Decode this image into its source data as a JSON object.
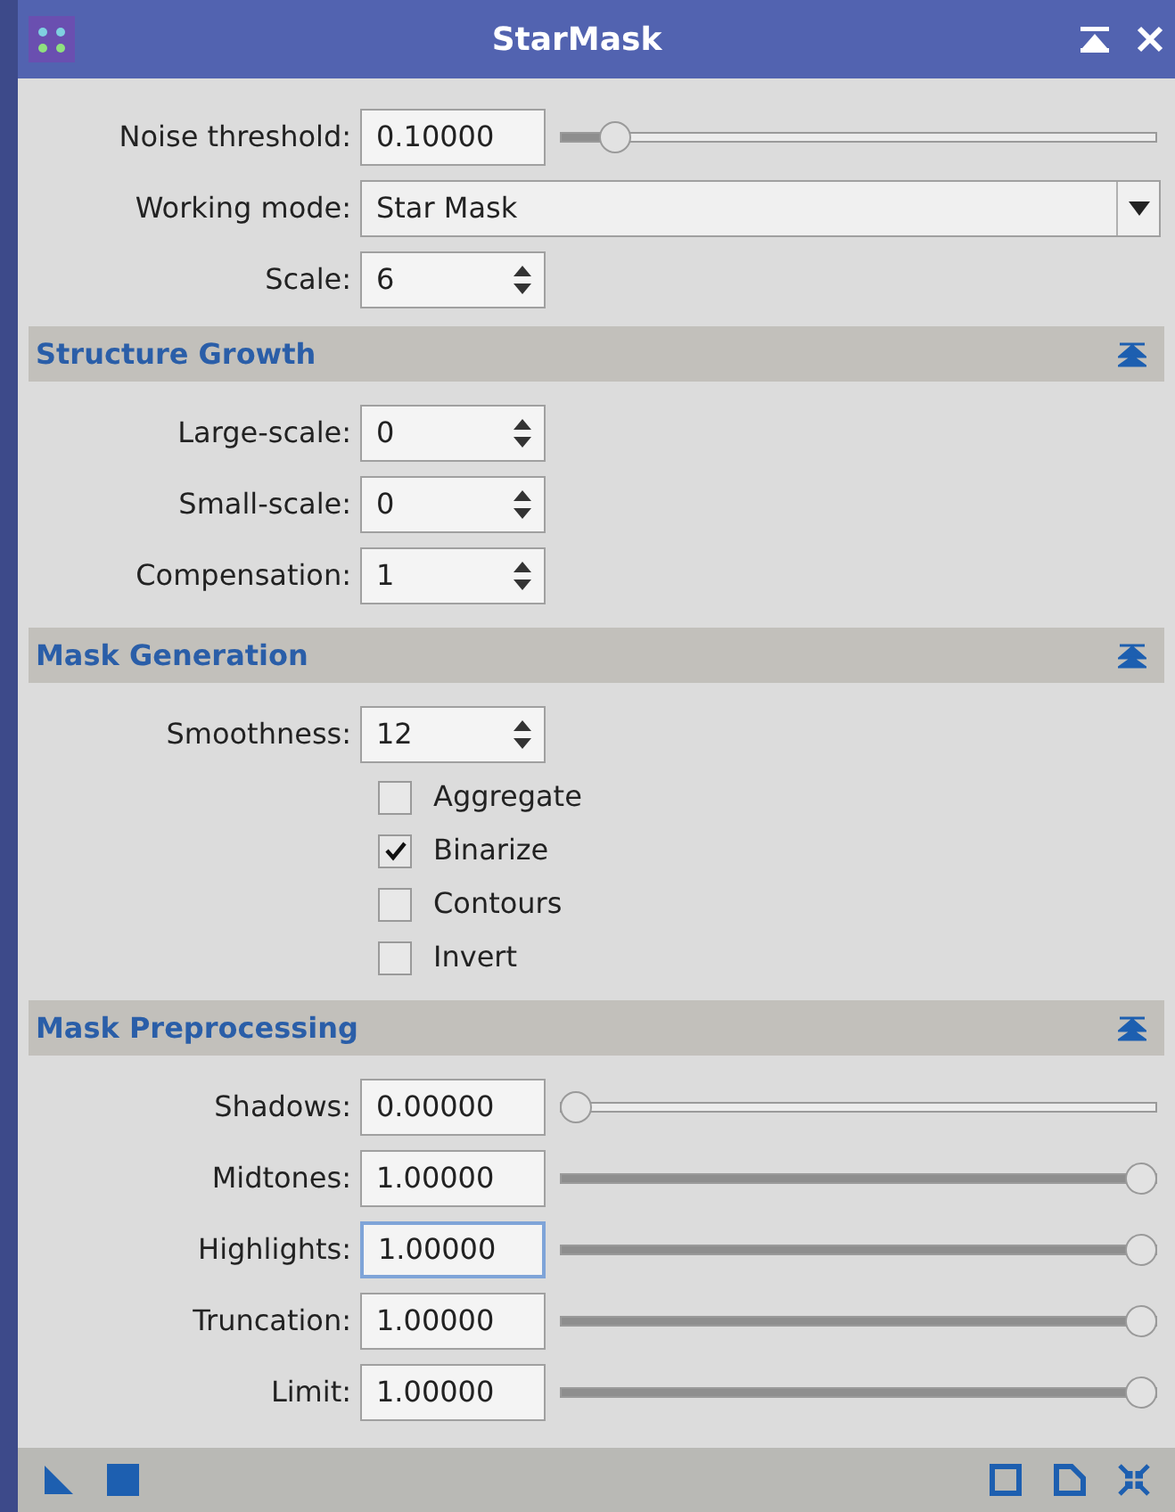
{
  "window": {
    "title": "StarMask"
  },
  "top_rows": [
    {
      "kind": "slider",
      "label": "Noise threshold:",
      "value": "0.10000",
      "level": 0.07
    },
    {
      "kind": "combo",
      "label": "Working mode:",
      "value": "Star Mask"
    },
    {
      "kind": "spin",
      "label": "Scale:",
      "value": "6"
    }
  ],
  "sections": [
    {
      "title": "Structure Growth",
      "expanded": true,
      "rows": [
        {
          "kind": "spin",
          "label": "Large-scale:",
          "value": "0"
        },
        {
          "kind": "spin",
          "label": "Small-scale:",
          "value": "0"
        },
        {
          "kind": "spin",
          "label": "Compensation:",
          "value": "1"
        }
      ]
    },
    {
      "title": "Mask Generation",
      "expanded": true,
      "rows": [
        {
          "kind": "spin",
          "label": "Smoothness:",
          "value": "12"
        },
        {
          "kind": "checkbox",
          "label": "Aggregate",
          "checked": false
        },
        {
          "kind": "checkbox",
          "label": "Binarize",
          "checked": true
        },
        {
          "kind": "checkbox",
          "label": "Contours",
          "checked": false
        },
        {
          "kind": "checkbox",
          "label": "Invert",
          "checked": false
        }
      ]
    },
    {
      "title": "Mask Preprocessing",
      "expanded": true,
      "rows": [
        {
          "kind": "slider",
          "label": "Shadows:",
          "value": "0.00000",
          "level": 0,
          "focused": false
        },
        {
          "kind": "slider",
          "label": "Midtones:",
          "value": "1.00000",
          "level": 1,
          "focused": false
        },
        {
          "kind": "slider",
          "label": "Highlights:",
          "value": "1.00000",
          "level": 1,
          "focused": true
        },
        {
          "kind": "slider",
          "label": "Truncation:",
          "value": "1.00000",
          "level": 1,
          "focused": false
        },
        {
          "kind": "slider",
          "label": "Limit:",
          "value": "1.00000",
          "level": 1,
          "focused": false
        }
      ]
    }
  ]
}
